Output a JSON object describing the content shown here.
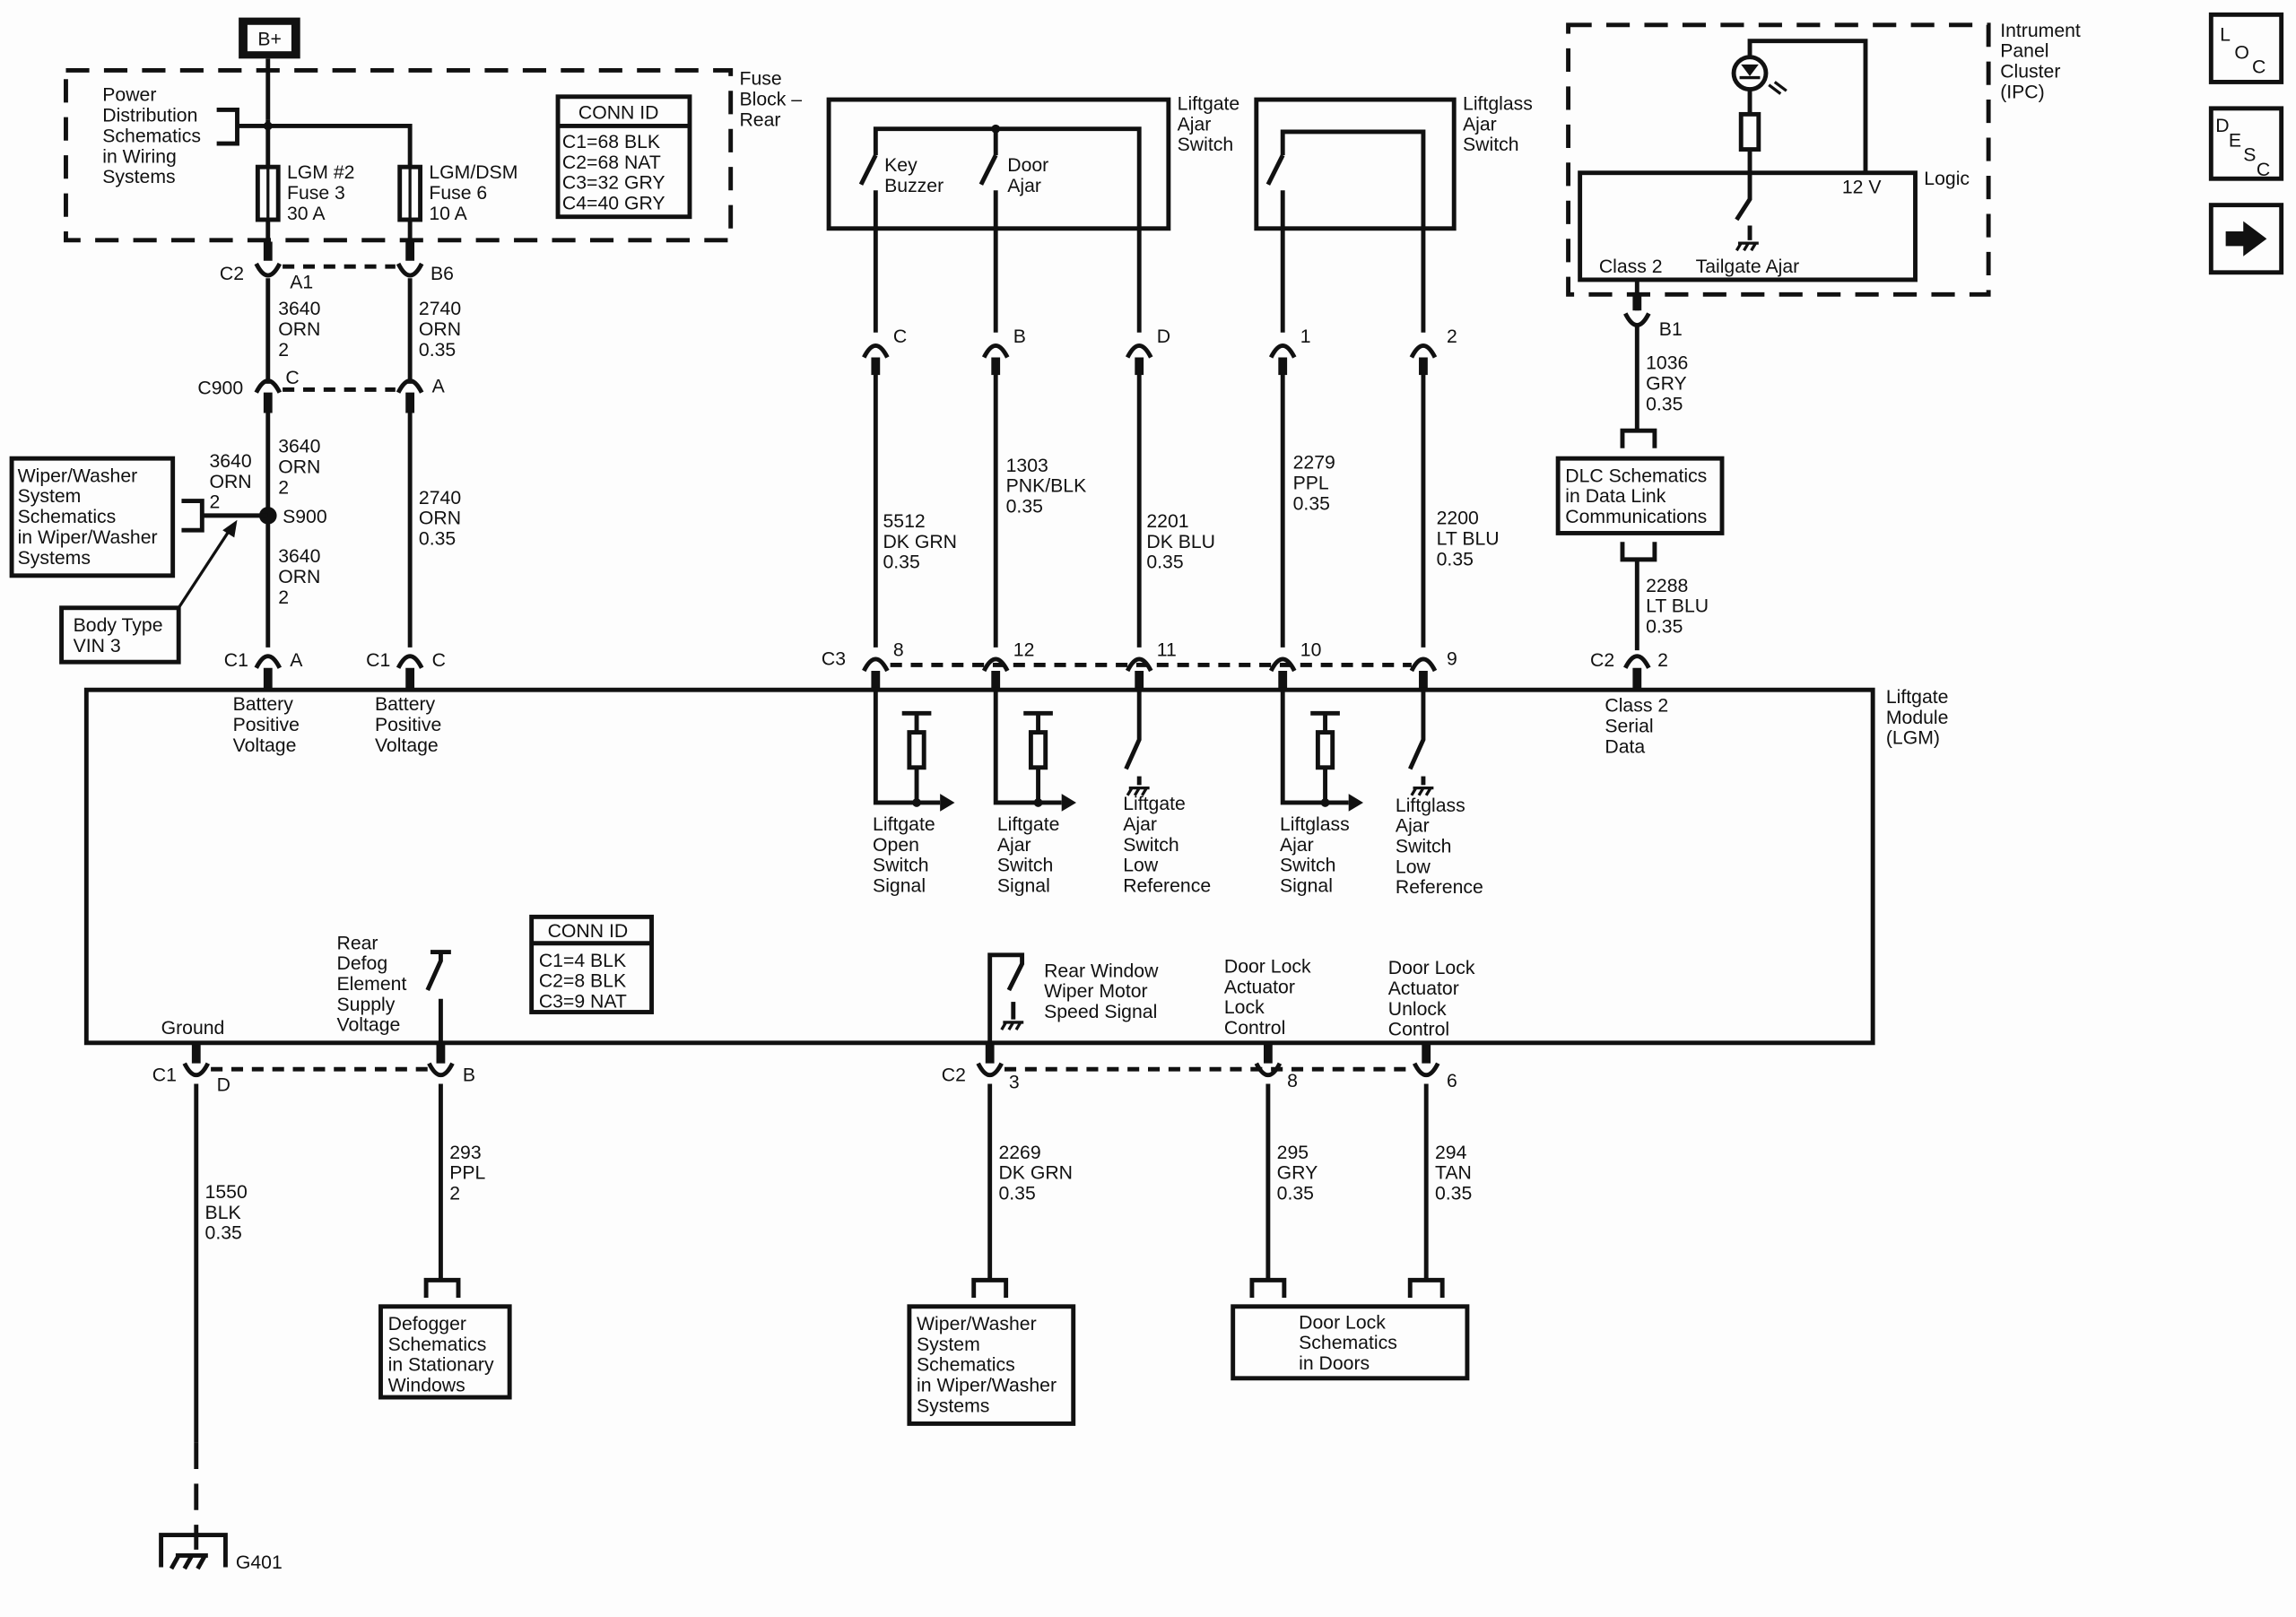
{
  "colors": {
    "ink": "#111111",
    "background": "#fdfdfd"
  },
  "power": {
    "label": "B+"
  },
  "fuse_block": {
    "label": [
      "Fuse",
      "Block –",
      "Rear"
    ],
    "ref_note": [
      "Power",
      "Distribution",
      "Schematics",
      "in Wiring",
      "Systems"
    ],
    "fuses": [
      {
        "lines": [
          "LGM #2",
          "Fuse 3",
          "30 A"
        ]
      },
      {
        "lines": [
          "LGM/DSM",
          "Fuse 6",
          "10 A"
        ]
      }
    ],
    "conn_id": {
      "title": "CONN ID",
      "rows": [
        "C1=68 BLK",
        "C2=68 NAT",
        "C3=32 GRY",
        "C4=40 GRY"
      ]
    }
  },
  "connectors": {
    "c2_top": {
      "name": "C2",
      "pins": [
        "A1",
        "B6"
      ]
    },
    "c900": {
      "name": "C900",
      "pins": [
        "C",
        "A"
      ]
    },
    "s900": {
      "name": "S900"
    },
    "c1_top": {
      "name": "C1",
      "pins": [
        "A",
        "C"
      ]
    },
    "c1_label_b": "C1",
    "c3": {
      "name": "C3",
      "pins": [
        "8",
        "12",
        "11",
        "10",
        "9"
      ]
    },
    "c2_right": {
      "name": "C2",
      "pins": [
        "2"
      ]
    },
    "ipc_b1": "B1",
    "c1_bottom": {
      "name": "C1",
      "pins": [
        "D",
        "B"
      ]
    },
    "c2_bottom": {
      "name": "C2",
      "pins": [
        "3",
        "8",
        "6"
      ]
    },
    "switch_pins": [
      "C",
      "B",
      "D",
      "1",
      "2"
    ]
  },
  "wires": {
    "w3640_a": [
      "3640",
      "ORN",
      "2"
    ],
    "w2740_a": [
      "2740",
      "ORN",
      "0.35"
    ],
    "w3640_b": [
      "3640",
      "ORN",
      "2"
    ],
    "w3640_side": [
      "3640",
      "ORN",
      "2"
    ],
    "w3640_c": [
      "3640",
      "ORN",
      "2"
    ],
    "w2740_b": [
      "2740",
      "ORN",
      "0.35"
    ],
    "w5512": [
      "5512",
      "DK GRN",
      "0.35"
    ],
    "w1303": [
      "1303",
      "PNK/BLK",
      "0.35"
    ],
    "w2201": [
      "2201",
      "DK BLU",
      "0.35"
    ],
    "w2279": [
      "2279",
      "PPL",
      "0.35"
    ],
    "w2200": [
      "2200",
      "LT BLU",
      "0.35"
    ],
    "w1036": [
      "1036",
      "GRY",
      "0.35"
    ],
    "w2288": [
      "2288",
      "LT BLU",
      "0.35"
    ],
    "w1550": [
      "1550",
      "BLK",
      "0.35"
    ],
    "w293": [
      "293",
      "PPL",
      "2"
    ],
    "w2269": [
      "2269",
      "DK GRN",
      "0.35"
    ],
    "w295": [
      "295",
      "GRY",
      "0.35"
    ],
    "w294": [
      "294",
      "TAN",
      "0.35"
    ]
  },
  "wiper_ref": [
    "Wiper/Washer",
    "System",
    "Schematics",
    "in Wiper/Washer",
    "Systems"
  ],
  "body_type": [
    "Body Type",
    "VIN 3"
  ],
  "liftgate_switch": {
    "label": [
      "Liftgate",
      "Ajar",
      "Switch"
    ],
    "key_buzzer": [
      "Key",
      "Buzzer"
    ],
    "door_ajar": [
      "Door",
      "Ajar"
    ]
  },
  "liftglass_switch": {
    "label": [
      "Liftglass",
      "Ajar",
      "Switch"
    ]
  },
  "ipc": {
    "label": [
      "Intrument",
      "Panel",
      "Cluster",
      "(IPC)"
    ],
    "logic": "Logic",
    "v12": "12 V",
    "class2": "Class 2",
    "tailgate": "Tailgate Ajar"
  },
  "dlc_ref": [
    "DLC Schematics",
    "in Data Link",
    "Communications"
  ],
  "lgm": {
    "label": [
      "Liftgate",
      "Module",
      "(LGM)"
    ],
    "batt1": [
      "Battery",
      "Positive",
      "Voltage"
    ],
    "batt2": [
      "Battery",
      "Positive",
      "Voltage"
    ],
    "class2": [
      "Class 2",
      "Serial",
      "Data"
    ],
    "sig1": [
      "Liftgate",
      "Open",
      "Switch",
      "Signal"
    ],
    "sig2": [
      "Liftgate",
      "Ajar",
      "Switch",
      "Signal"
    ],
    "sig3": [
      "Liftgate",
      "Ajar",
      "Switch",
      "Low",
      "Reference"
    ],
    "sig4": [
      "Liftglass",
      "Ajar",
      "Switch",
      "Signal"
    ],
    "sig5": [
      "Liftglass",
      "Ajar",
      "Switch",
      "Low",
      "Reference"
    ],
    "conn_id": {
      "title": "CONN ID",
      "rows": [
        "C1=4 BLK",
        "C2=8 BLK",
        "C3=9 NAT"
      ]
    },
    "rear_defog": [
      "Rear",
      "Defog",
      "Element",
      "Supply",
      "Voltage"
    ],
    "ground": "Ground",
    "rear_wiper": [
      "Rear Window",
      "Wiper Motor",
      "Speed Signal"
    ],
    "lock": [
      "Door Lock",
      "Actuator",
      "Lock",
      "Control"
    ],
    "unlock": [
      "Door Lock",
      "Actuator",
      "Unlock",
      "Control"
    ]
  },
  "defogger_ref": [
    "Defogger",
    "Schematics",
    "in Stationary",
    "Windows"
  ],
  "wiper_ref_bottom": [
    "Wiper/Washer",
    "System",
    "Schematics",
    "in Wiper/Washer",
    "Systems"
  ],
  "door_lock_ref": [
    "Door Lock",
    "Schematics",
    "in Doors"
  ],
  "ground_label": "G401",
  "nav": {
    "loc": [
      "L",
      "O",
      "C"
    ],
    "desc": [
      "D",
      "E",
      "S",
      "C"
    ],
    "next": "arrow-right"
  }
}
